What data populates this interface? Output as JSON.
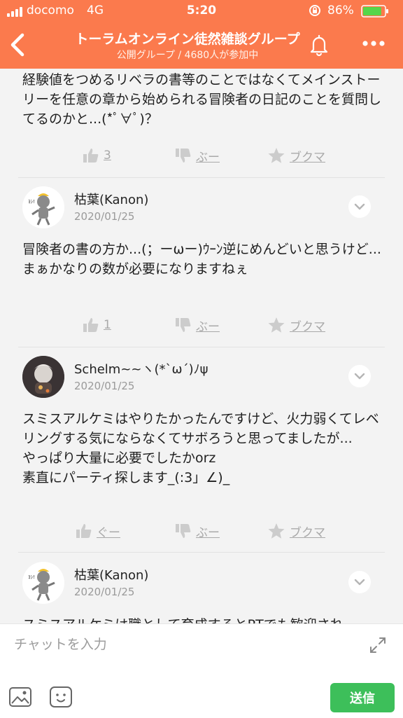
{
  "status_bar": {
    "carrier": "docomo",
    "network": "4G",
    "time": "5:20",
    "battery": "86%",
    "battery_level": 0.86
  },
  "header": {
    "title": "トーラムオンライン徒然雑談グループ",
    "subtitle": "公開グループ / 4680人が参加中",
    "back_icon": "chevron-left-icon",
    "bell_icon": "bell-icon",
    "more_icon": "more-icon"
  },
  "feed": [
    {
      "author": "",
      "date": "",
      "text": "経験値をつめるリベラの書等のことではなくてメインストーリーを任意の章から始められる冒険者の日記のことを質問してるのかと...(*ﾟ∀ﾟ)？",
      "actions": {
        "like": "3",
        "dislike": "ぶー",
        "bookmark": "ブクマ"
      }
    },
    {
      "author": "枯葉(Kanon)",
      "date": "2020/01/25",
      "text": "冒険者の書の方か...(；ーωー)ｳｰﾝ逆にめんどいと思うけど...\nまぁかなりの数が必要になりますねぇ",
      "actions": {
        "like": "1",
        "dislike": "ぶー",
        "bookmark": "ブクマ"
      }
    },
    {
      "author": "Schelm~~ヽ(*`ω´)ﾉψ",
      "date": "2020/01/25",
      "text": "スミスアルケミはやりたかったんですけど、火力弱くてレベリングする気にならなくてサボろうと思ってましたが...\nやっぱり大量に必要でしたかorz\n素直にパーティ探します_(:3」∠)_",
      "actions": {
        "like": "ぐー",
        "dislike": "ぶー",
        "bookmark": "ブクマ"
      }
    },
    {
      "author": "枯葉(Kanon)",
      "date": "2020/01/25",
      "text": "スミスアルケミは職として育成するとPTでも歓迎され"
    }
  ],
  "input": {
    "placeholder": "チャットを入力",
    "send_label": "送信"
  },
  "colors": {
    "header": "#fb7a4d",
    "send": "#3dbf5a",
    "background": "#f3f3f3"
  }
}
